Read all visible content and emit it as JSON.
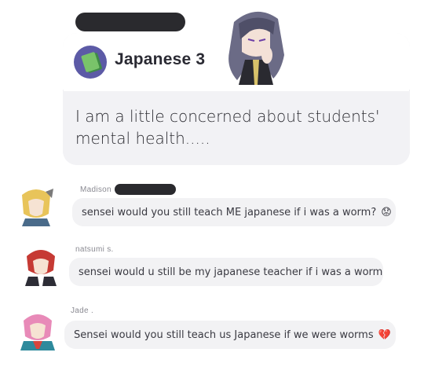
{
  "post": {
    "class_name": "Japanese 3",
    "body": "I am a little concerned about students' mental health....."
  },
  "comments": [
    {
      "author": "Madison",
      "text": "sensei would you still teach ME japanese if i was a worm?",
      "emoji": "😟"
    },
    {
      "author": "natsumi s.",
      "text": "sensei would u still be my japanese teacher if i was a worm",
      "emoji": ""
    },
    {
      "author": "Jade .",
      "text": "Sensei would you still teach us Japanese if we were worms",
      "emoji": "💔"
    }
  ],
  "colors": {
    "class_icon_bg": "#5c5aa6",
    "bubble_bg": "#f2f2f4",
    "post_body_bg": "#f2f2f5",
    "redaction": "#2a2a2e",
    "broken_heart": "#d9453c"
  },
  "icons": [
    "book-icon",
    "worried-face-emoji",
    "broken-heart-emoji"
  ]
}
